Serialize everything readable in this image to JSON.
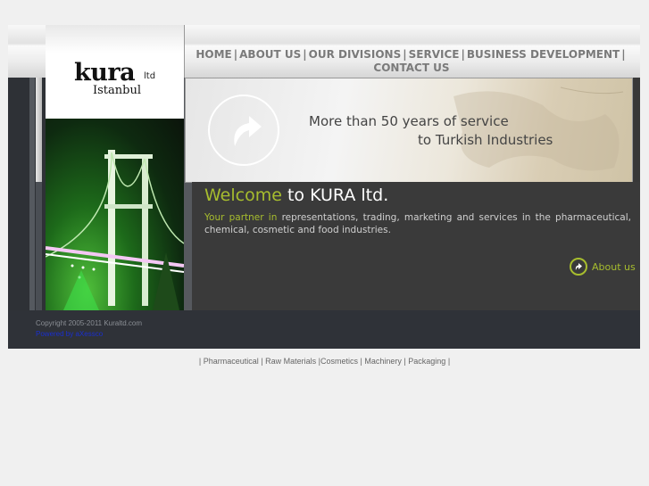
{
  "logo": {
    "name": "kura",
    "suffix": "ltd",
    "city": "Istanbul"
  },
  "nav": {
    "items": [
      "HOME",
      "ABOUT US",
      "OUR DIVISIONS",
      "SERVICE",
      "BUSINESS DEVELOPMENT",
      "CONTACT US"
    ],
    "separator": "|"
  },
  "banner": {
    "line1": "More than 50 years of service",
    "line2": "to Turkish Industries"
  },
  "welcome": {
    "highlight": "Welcome",
    "rest": " to KURA ltd."
  },
  "intro": {
    "highlight": "Your partner in",
    "rest": " representations, trading, marketing and services in the pharmaceutical, chemical, cosmetic and food industries."
  },
  "about_link": {
    "label": "About us"
  },
  "footer": {
    "copyright": "Copyright 2005-2011 Kuraltd.com",
    "powered": "Powered by aXessco"
  },
  "bottom_links": {
    "items": [
      "Pharmaceutical",
      "Raw Materials",
      "Cosmetics",
      "Machinery",
      "Packaging"
    ],
    "separator": "|"
  },
  "colors": {
    "accent": "#a7bd2e",
    "nav_text": "#7a7a7a",
    "content_bg": "#3a3a3a",
    "footer_bg": "#2f3238",
    "link_blue": "#1a2fd0"
  }
}
